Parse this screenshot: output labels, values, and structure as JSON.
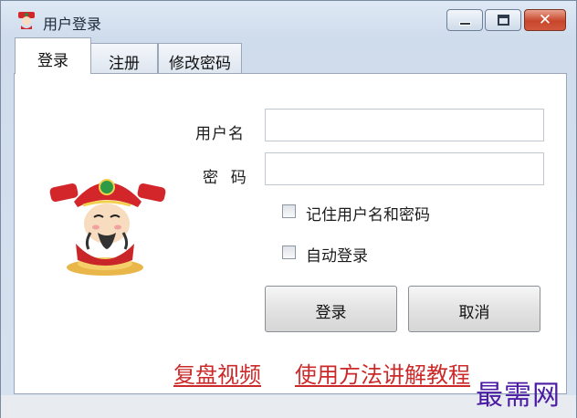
{
  "window": {
    "title": "用户登录",
    "controls": {
      "minimize": "minimize",
      "maximize": "maximize",
      "close": "✕"
    }
  },
  "tabs": [
    {
      "label": "登录",
      "active": true
    },
    {
      "label": "注册",
      "active": false
    },
    {
      "label": "修改密码",
      "active": false
    }
  ],
  "form": {
    "username_label": "用户名",
    "username_value": "",
    "password_label": "密  码",
    "password_value": "",
    "remember_label": "记住用户名和密码",
    "remember_checked": false,
    "autologin_label": "自动登录",
    "autologin_checked": false
  },
  "buttons": {
    "login": "登录",
    "cancel": "取消"
  },
  "links": {
    "replay_video": "复盘视频",
    "tutorial": "使用方法讲解教程"
  },
  "watermark": "最需网",
  "colors": {
    "link": "#cc2a2a",
    "watermark": "#4b1ca3",
    "close_button": "#c7452b"
  },
  "icons": {
    "app": "god-of-wealth-icon",
    "mascot": "god-of-wealth-mascot"
  }
}
